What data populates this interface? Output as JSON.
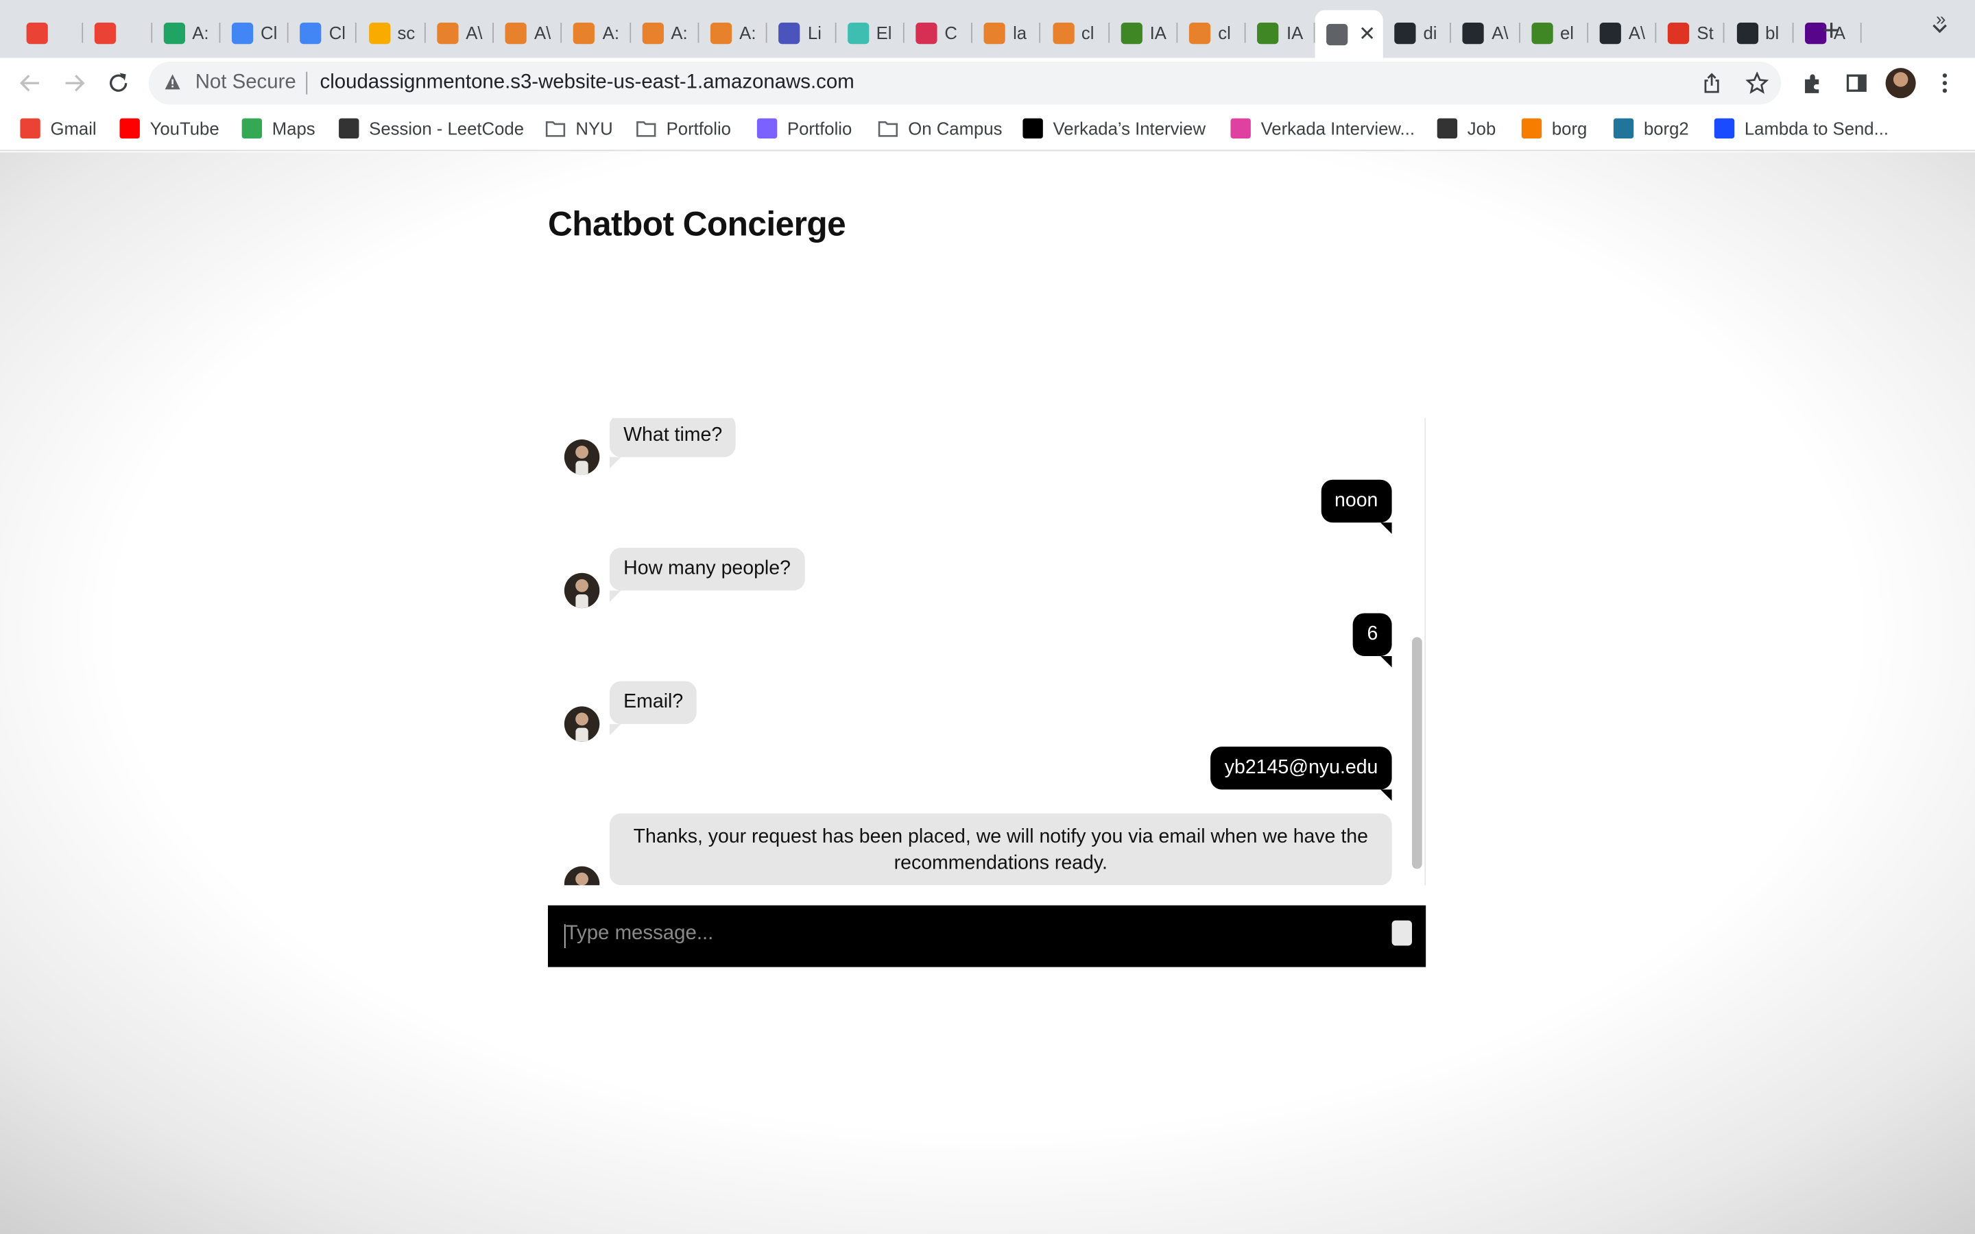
{
  "browser": {
    "tabs": [
      {
        "label": "",
        "icon": "gmail-icon",
        "color": "#ea4335"
      },
      {
        "label": "",
        "icon": "gmail-icon",
        "color": "#ea4335"
      },
      {
        "label": "A:",
        "icon": "google-drive-icon",
        "color": "#1fa463"
      },
      {
        "label": "Cl",
        "icon": "google-docs-icon",
        "color": "#4285f4"
      },
      {
        "label": "Cl",
        "icon": "google-docs-icon",
        "color": "#4285f4"
      },
      {
        "label": "sc",
        "icon": "colab-icon",
        "color": "#f9ab00"
      },
      {
        "label": "A\\",
        "icon": "aws-cube-icon",
        "color": "#e7812b"
      },
      {
        "label": "A\\",
        "icon": "aws-cube-icon",
        "color": "#e7812b"
      },
      {
        "label": "A:",
        "icon": "aws-cube-icon",
        "color": "#e7812b"
      },
      {
        "label": "A:",
        "icon": "aws-cube-icon",
        "color": "#e7812b"
      },
      {
        "label": "A:",
        "icon": "aws-cube-icon",
        "color": "#e7812b"
      },
      {
        "label": "Li",
        "icon": "aws-service-icon",
        "color": "#4b53bc"
      },
      {
        "label": "El",
        "icon": "elastic-icon",
        "color": "#3ebeb0"
      },
      {
        "label": "C",
        "icon": "opensearch-icon",
        "color": "#d62f53"
      },
      {
        "label": "la",
        "icon": "lambda-icon",
        "color": "#e7812b"
      },
      {
        "label": "cl",
        "icon": "lambda-icon",
        "color": "#e7812b"
      },
      {
        "label": "IA",
        "icon": "iam-key-icon",
        "color": "#3f8624"
      },
      {
        "label": "cl",
        "icon": "lambda-icon",
        "color": "#e7812b"
      },
      {
        "label": "IA",
        "icon": "iam-key-icon",
        "color": "#3f8624"
      },
      {
        "label": "",
        "icon": "globe-icon",
        "color": "#5f6368",
        "active": true
      },
      {
        "label": "di",
        "icon": "github-icon",
        "color": "#24292f"
      },
      {
        "label": "A\\",
        "icon": "github-icon",
        "color": "#24292f"
      },
      {
        "label": "el",
        "icon": "elastic-person-icon",
        "color": "#3f8624"
      },
      {
        "label": "A\\",
        "icon": "github-icon",
        "color": "#24292f"
      },
      {
        "label": "St",
        "icon": "scala-icon",
        "color": "#de3423"
      },
      {
        "label": "bl",
        "icon": "github-icon",
        "color": "#24292f"
      },
      {
        "label": "A",
        "icon": "nyu-torch-icon",
        "color": "#57068c"
      }
    ],
    "security_label": "Not Secure",
    "url": "cloudassignmentone.s3-website-us-east-1.amazonaws.com",
    "bookmarks": [
      {
        "label": "Gmail",
        "icon": "gmail-icon",
        "color": "#ea4335"
      },
      {
        "label": "YouTube",
        "icon": "youtube-icon",
        "color": "#ff0000"
      },
      {
        "label": "Maps",
        "icon": "maps-pin-icon",
        "color": "#34a853"
      },
      {
        "label": "Session - LeetCode",
        "icon": "leetcode-icon",
        "color": "#333333"
      },
      {
        "label": "NYU",
        "icon": "folder-icon",
        "color": "#5f6368"
      },
      {
        "label": "Portfolio",
        "icon": "folder-icon",
        "color": "#5f6368"
      },
      {
        "label": "Portfolio",
        "icon": "portfolio-eye-icon",
        "color": "#7b61ff"
      },
      {
        "label": "On Campus",
        "icon": "folder-icon",
        "color": "#5f6368"
      },
      {
        "label": "Verkada’s Interview",
        "icon": "medium-icon",
        "color": "#000000"
      },
      {
        "label": "Verkada Interview...",
        "icon": "verkada-icon",
        "color": "#e040a0"
      },
      {
        "label": "Job",
        "icon": "notion-icon",
        "color": "#333333"
      },
      {
        "label": "borg",
        "icon": "blogger-icon",
        "color": "#f57d00"
      },
      {
        "label": "borg2",
        "icon": "wordpress-icon",
        "color": "#21759b"
      },
      {
        "label": "Lambda to Send...",
        "icon": "pe-icon",
        "color": "#1a4bff"
      }
    ]
  },
  "app": {
    "title": "Chatbot Concierge",
    "messages": [
      {
        "from": "bot",
        "text": "What time?"
      },
      {
        "from": "user",
        "text": "noon"
      },
      {
        "from": "bot",
        "text": "How many people?"
      },
      {
        "from": "user",
        "text": "6"
      },
      {
        "from": "bot",
        "text": "Email?"
      },
      {
        "from": "user",
        "text": "yb2145@nyu.edu"
      },
      {
        "from": "bot",
        "text": "Thanks, your request has been placed, we will notify you via email when we have the recommendations ready."
      }
    ],
    "input_placeholder": "Type message...",
    "colors": {
      "user_bubble": "#000000",
      "bot_bubble": "#e6e6e6",
      "input_bar": "#000000"
    }
  }
}
